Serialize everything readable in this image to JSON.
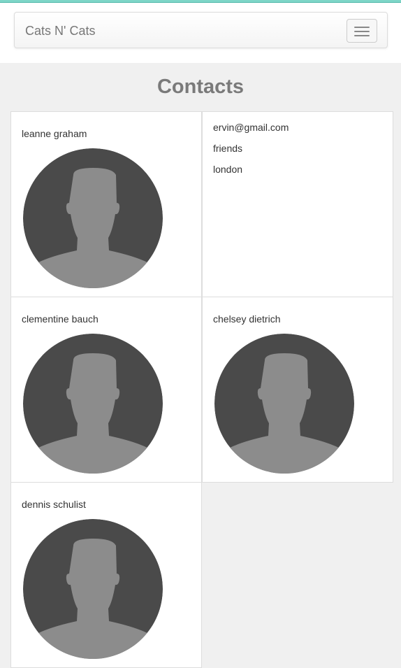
{
  "navbar": {
    "brand": "Cats N' Cats",
    "toggle_icon": "hamburger-menu-icon"
  },
  "page": {
    "title": "Contacts"
  },
  "contacts": [
    {
      "name": "leanne graham",
      "avatar_icon": "person-silhouette-icon"
    },
    {
      "email": "ervin@gmail.com",
      "group": "friends",
      "city": "london"
    },
    {
      "name": "clementine bauch",
      "avatar_icon": "person-silhouette-icon"
    },
    {
      "name": "chelsey dietrich",
      "avatar_icon": "person-silhouette-icon"
    },
    {
      "name": "dennis schulist",
      "avatar_icon": "person-silhouette-icon"
    }
  ],
  "colors": {
    "accent_top": "#7fd6c8",
    "avatar_dark": "#4a4a4a",
    "avatar_light": "#8c8c8c",
    "title": "#7a7a7a"
  }
}
